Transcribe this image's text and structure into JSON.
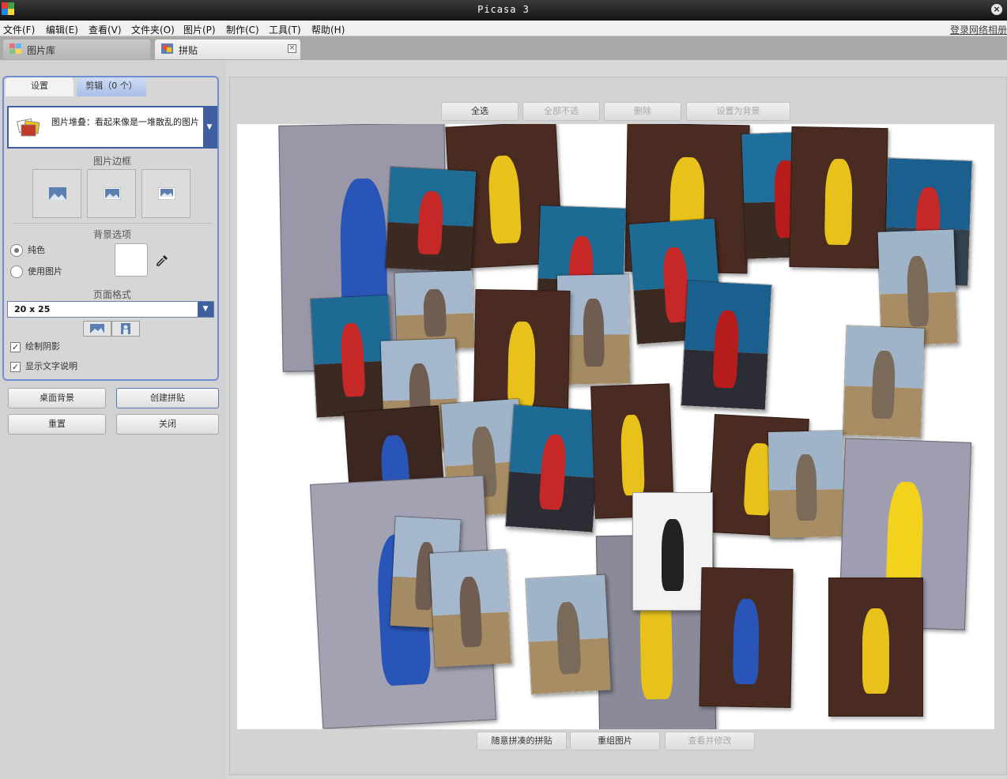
{
  "window": {
    "title": "Picasa 3"
  },
  "menu": {
    "items": [
      "文件(F)",
      "编辑(E)",
      "查看(V)",
      "文件夹(O)",
      "图片(P)",
      "制作(C)",
      "工具(T)",
      "帮助(H)"
    ],
    "login": "登录网络相册"
  },
  "tabs": {
    "library": "图片库",
    "collage": "拼贴"
  },
  "panel": {
    "subtabs": {
      "settings": "设置",
      "clips": "剪辑（0 个）"
    },
    "style": "图片堆叠：看起来像是一堆散乱的图片",
    "border_label": "图片边框",
    "background_label": "背景选项",
    "bg_solid": "纯色",
    "bg_image": "使用图片",
    "bg_color": "#ffffff",
    "page_format_label": "页面格式",
    "page_format_value": "20 x 25",
    "draw_shadow": "绘制阴影",
    "show_captions": "显示文字说明",
    "buttons": {
      "desktop": "桌面背景",
      "create": "创建拼贴",
      "reset": "重置",
      "close": "关闭"
    }
  },
  "main": {
    "top_buttons": {
      "select_all": "全选",
      "deselect_all": "全部不选",
      "delete": "删除",
      "set_background": "设置为背景"
    },
    "bottom_buttons": {
      "scramble": "随意拼凑的拼贴",
      "shuffle": "重组图片",
      "view_edits": "查看并修改"
    }
  }
}
